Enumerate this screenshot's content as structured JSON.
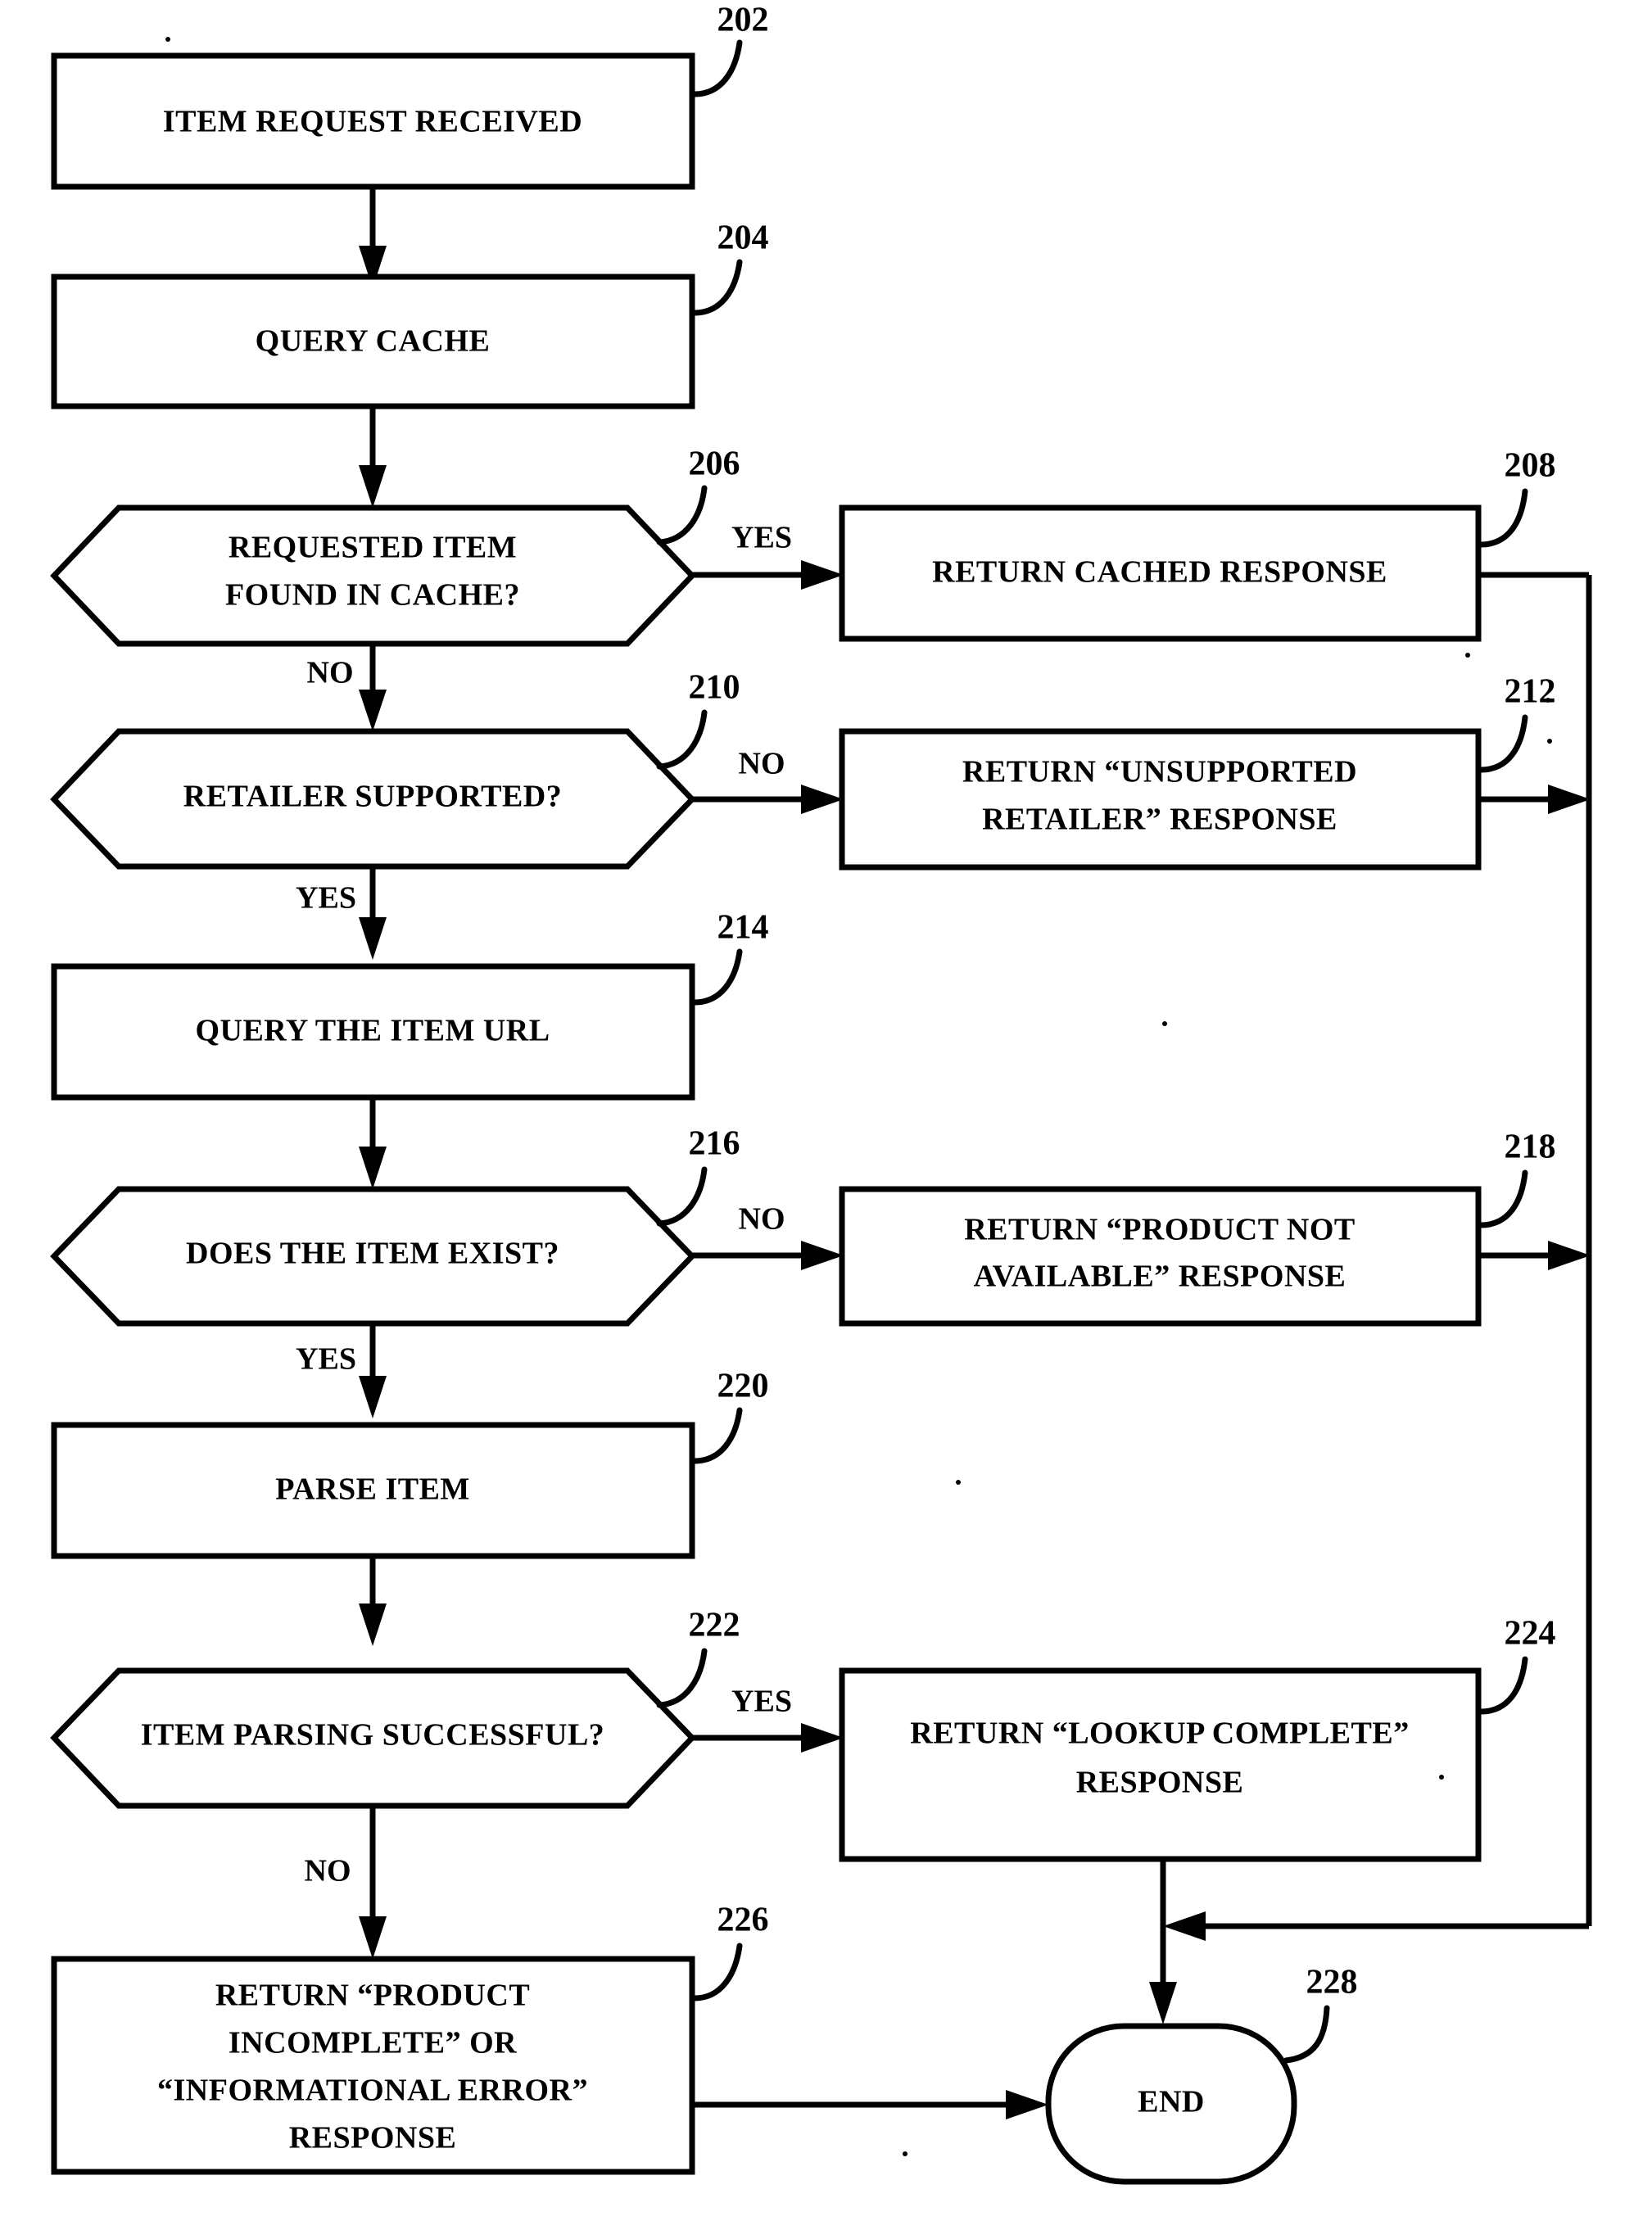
{
  "figure": {
    "type": "patent-flowchart",
    "background_color": "#ffffff",
    "line_color": "#000000"
  },
  "nodes": [
    {
      "id": "n202",
      "ref": "202",
      "shape": "process",
      "lines": [
        "ITEM REQUEST RECEIVED"
      ]
    },
    {
      "id": "n204",
      "ref": "204",
      "shape": "process",
      "lines": [
        "QUERY CACHE"
      ]
    },
    {
      "id": "n206",
      "ref": "206",
      "shape": "decision",
      "lines": [
        "REQUESTED ITEM",
        "FOUND IN CACHE?"
      ]
    },
    {
      "id": "n208",
      "ref": "208",
      "shape": "process",
      "lines": [
        "RETURN CACHED RESPONSE"
      ]
    },
    {
      "id": "n210",
      "ref": "210",
      "shape": "decision",
      "lines": [
        "RETAILER SUPPORTED?"
      ]
    },
    {
      "id": "n212",
      "ref": "212",
      "shape": "process",
      "lines": [
        "RETURN “UNSUPPORTED",
        "RETAILER” RESPONSE"
      ]
    },
    {
      "id": "n214",
      "ref": "214",
      "shape": "process",
      "lines": [
        "QUERY THE ITEM URL"
      ]
    },
    {
      "id": "n216",
      "ref": "216",
      "shape": "decision",
      "lines": [
        "DOES THE ITEM EXIST?"
      ]
    },
    {
      "id": "n218",
      "ref": "218",
      "shape": "process",
      "lines": [
        "RETURN “PRODUCT NOT",
        "AVAILABLE” RESPONSE"
      ]
    },
    {
      "id": "n220",
      "ref": "220",
      "shape": "process",
      "lines": [
        "PARSE ITEM"
      ]
    },
    {
      "id": "n222",
      "ref": "222",
      "shape": "decision",
      "lines": [
        "ITEM PARSING SUCCESSFUL?"
      ]
    },
    {
      "id": "n224",
      "ref": "224",
      "shape": "process",
      "lines": [
        "RETURN “LOOKUP COMPLETE”",
        "RESPONSE"
      ]
    },
    {
      "id": "n226",
      "ref": "226",
      "shape": "process",
      "lines": [
        "RETURN “PRODUCT",
        "INCOMPLETE” OR",
        "“INFORMATIONAL ERROR”",
        "RESPONSE"
      ]
    },
    {
      "id": "n228",
      "ref": "228",
      "shape": "terminator",
      "lines": [
        "END"
      ]
    }
  ],
  "edge_labels": {
    "cache_yes": "YES",
    "cache_no": "NO",
    "retailer_no": "NO",
    "retailer_yes": "YES",
    "exists_no": "NO",
    "exists_yes": "YES",
    "parsing_yes": "YES",
    "parsing_no": "NO"
  },
  "ref_numbers": {
    "r202": "202",
    "r204": "204",
    "r206": "206",
    "r208": "208",
    "r210": "210",
    "r212": "212",
    "r214": "214",
    "r216": "216",
    "r218": "218",
    "r220": "220",
    "r222": "222",
    "r224": "224",
    "r226": "226",
    "r228": "228"
  },
  "node_text": {
    "n202_l1": "ITEM REQUEST RECEIVED",
    "n204_l1": "QUERY CACHE",
    "n206_l1": "REQUESTED ITEM",
    "n206_l2": "FOUND IN CACHE?",
    "n208_l1": "RETURN CACHED RESPONSE",
    "n210_l1": "RETAILER SUPPORTED?",
    "n212_l1": "RETURN “UNSUPPORTED",
    "n212_l2": "RETAILER” RESPONSE",
    "n214_l1": "QUERY THE ITEM URL",
    "n216_l1": "DOES THE ITEM EXIST?",
    "n218_l1": "RETURN “PRODUCT NOT",
    "n218_l2": "AVAILABLE” RESPONSE",
    "n220_l1": "PARSE ITEM",
    "n222_l1": "ITEM PARSING SUCCESSFUL?",
    "n224_l1": "RETURN “LOOKUP COMPLETE”",
    "n224_l2": "RESPONSE",
    "n226_l1": "RETURN “PRODUCT",
    "n226_l2": "INCOMPLETE” OR",
    "n226_l3": "“INFORMATIONAL ERROR”",
    "n226_l4": "RESPONSE",
    "n228_l1": "END"
  }
}
